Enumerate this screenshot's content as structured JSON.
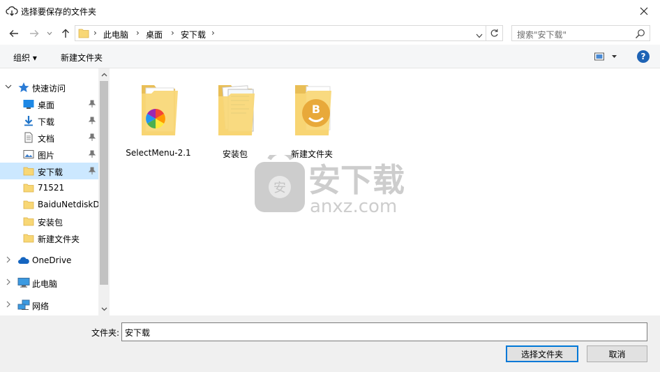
{
  "window": {
    "title": "选择要保存的文件夹",
    "close_icon": "close-icon"
  },
  "address": {
    "crumbs": [
      "此电脑",
      "桌面",
      "安下载"
    ],
    "search_placeholder": "搜索\"安下载\""
  },
  "toolbar": {
    "organize_label": "组织 ▾",
    "new_folder_label": "新建文件夹",
    "help_label": "?"
  },
  "sidebar": {
    "quick_access": "快速访问",
    "items": [
      {
        "label": "桌面",
        "icon": "desktop-icon",
        "pinned": true
      },
      {
        "label": "下载",
        "icon": "download-icon",
        "pinned": true
      },
      {
        "label": "文档",
        "icon": "document-icon",
        "pinned": true
      },
      {
        "label": "图片",
        "icon": "picture-icon",
        "pinned": true
      },
      {
        "label": "安下载",
        "icon": "folder-icon",
        "pinned": true,
        "selected": true
      },
      {
        "label": "71521",
        "icon": "folder-icon"
      },
      {
        "label": "BaiduNetdiskD",
        "icon": "folder-icon"
      },
      {
        "label": "安装包",
        "icon": "folder-icon"
      },
      {
        "label": "新建文件夹",
        "icon": "folder-icon"
      }
    ],
    "onedrive": "OneDrive",
    "this_pc": "此电脑",
    "network": "网络"
  },
  "content": {
    "files": [
      {
        "name": "SelectMenu-2.1",
        "icon": "folder-icon"
      },
      {
        "name": "安装包",
        "icon": "folder-icon"
      },
      {
        "name": "新建文件夹",
        "icon": "folder-icon"
      }
    ],
    "watermark_cn": "安下载",
    "watermark_en": "anxz.com"
  },
  "footer": {
    "folder_label": "文件夹:",
    "folder_value": "安下载",
    "select_button": "选择文件夹",
    "cancel_button": "取消"
  },
  "colors": {
    "accent": "#0078d7",
    "selection": "#cce8ff",
    "folder_yellow": "#f8d775"
  }
}
